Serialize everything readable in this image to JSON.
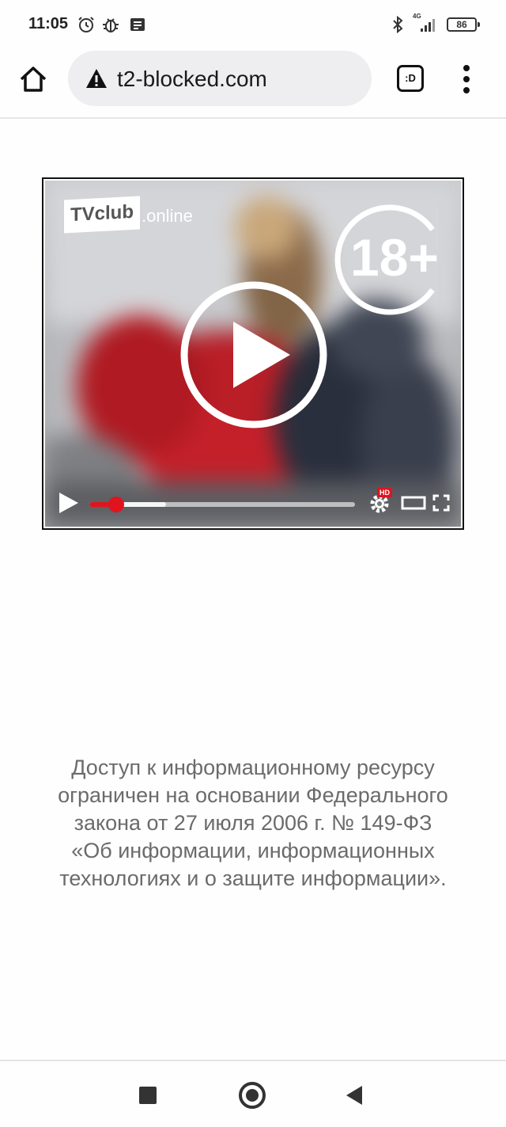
{
  "status_bar": {
    "time": "11:05",
    "network": "4G",
    "battery": "86"
  },
  "browser": {
    "url": "t2-blocked.com",
    "tabs_label": ":D",
    "security_icon": "warning-triangle-icon"
  },
  "player": {
    "logo_main": "TVclub",
    "logo_suffix": ".online",
    "age_rating": "18+",
    "hd_label": "HD",
    "progress_played": 0.1,
    "progress_buffered": 0.29
  },
  "notice": {
    "lines": [
      "Доступ к информационному ресурсу",
      "ограничен на основании Федерального",
      "закона от 27 июля 2006 г. № 149-ФЗ",
      "«Об информации, информационных",
      "технологиях и о защите информации»."
    ]
  },
  "colors": {
    "accent_red": "#e0141e",
    "notice_text": "#6b6b6b"
  }
}
